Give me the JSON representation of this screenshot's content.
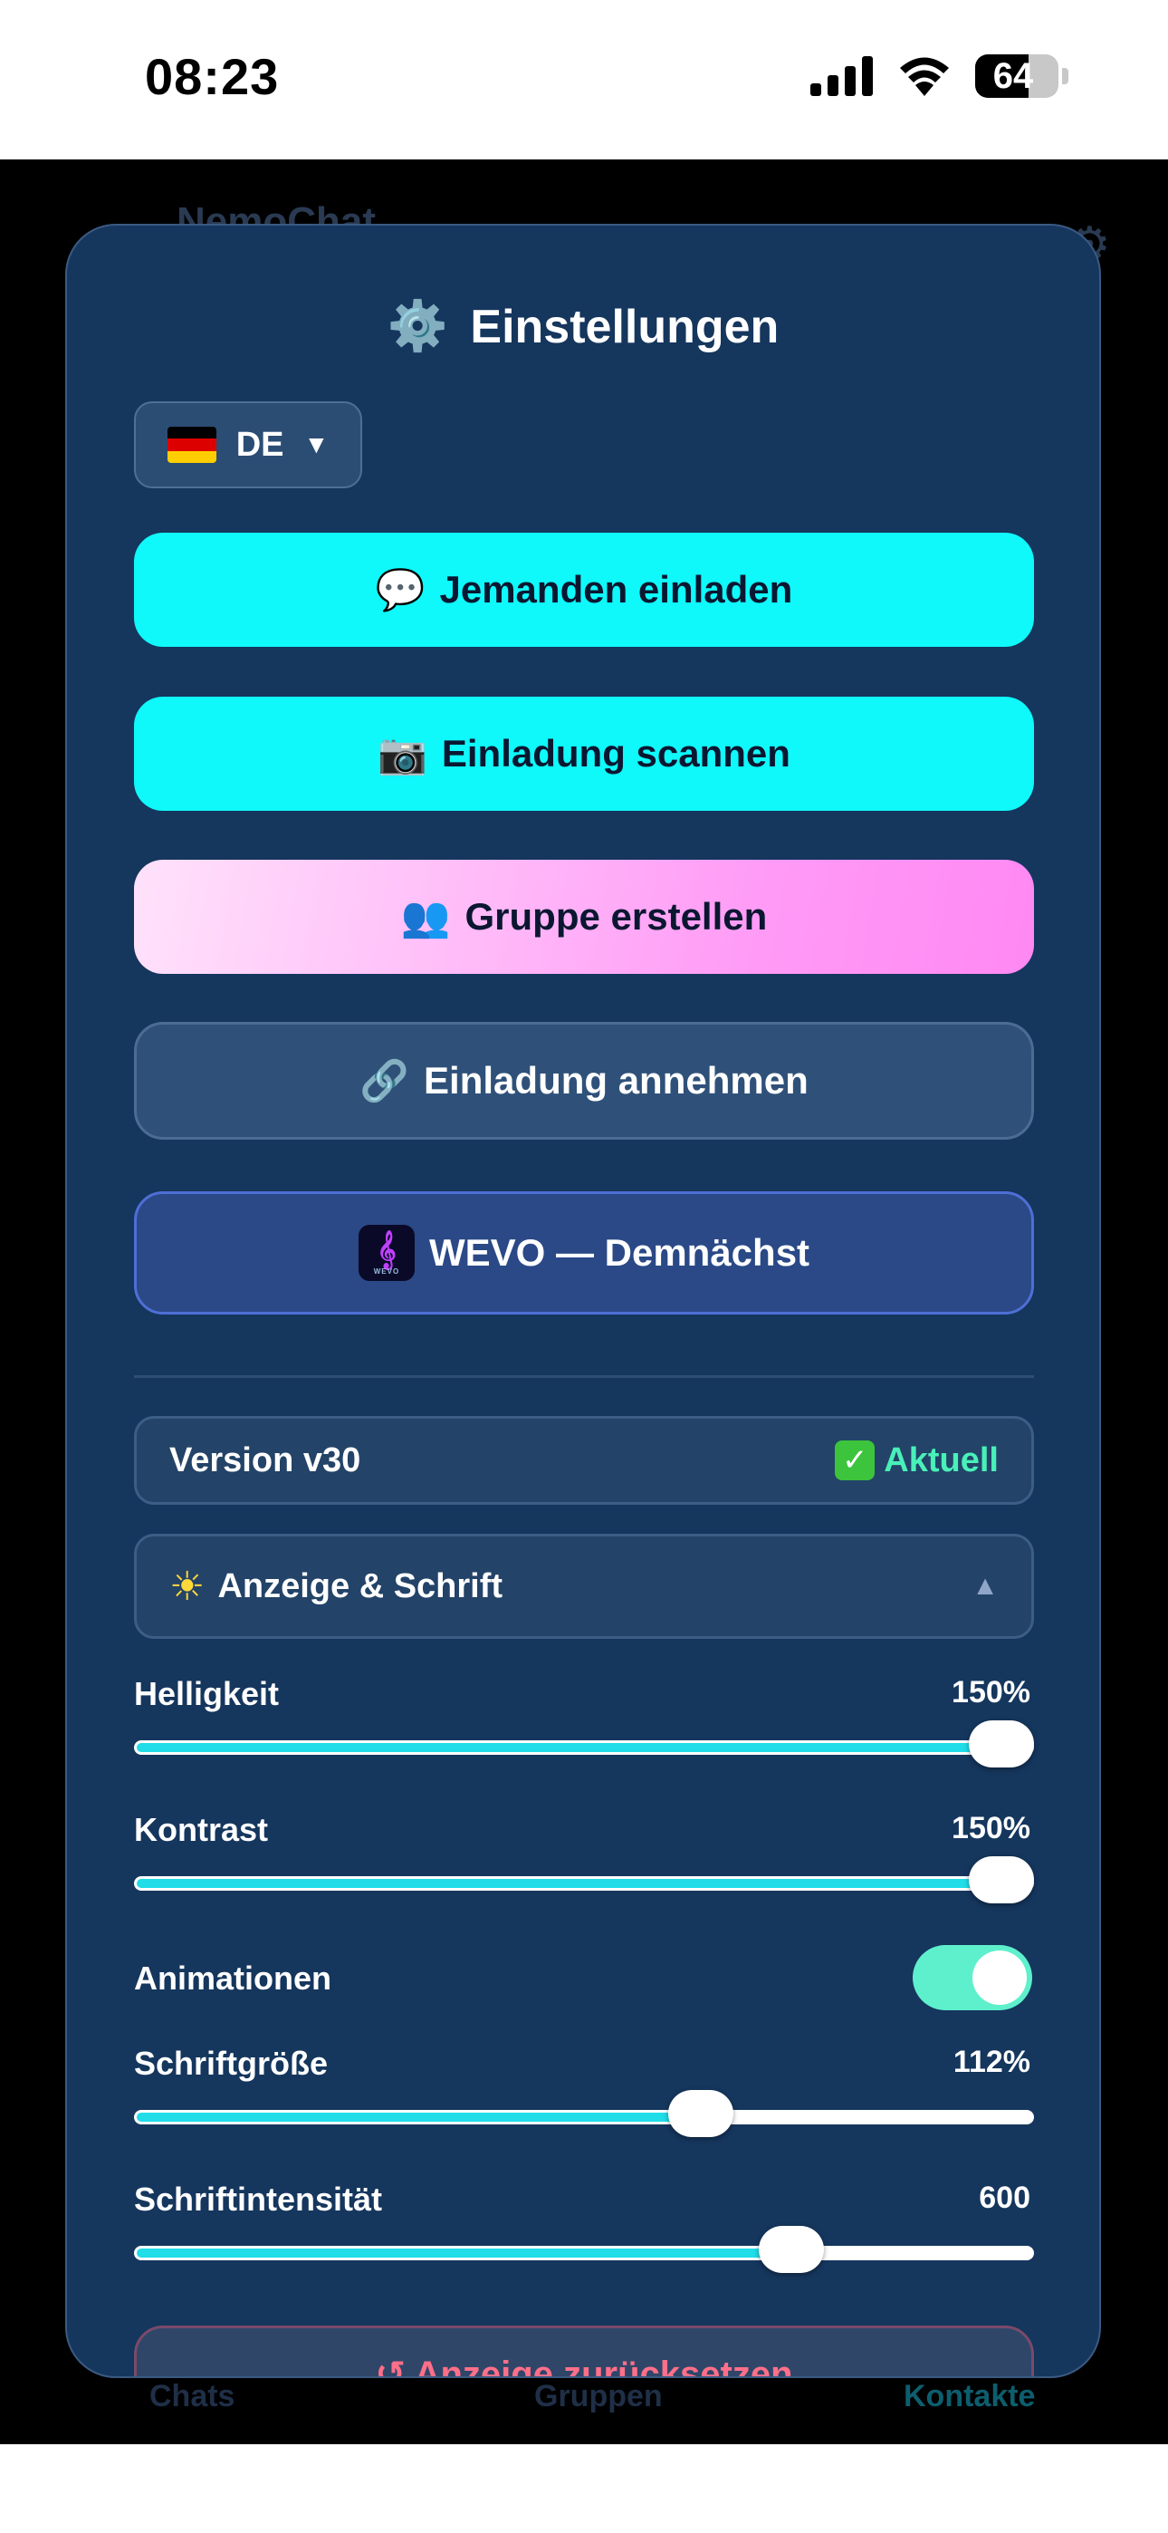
{
  "status_bar": {
    "time": "08:23",
    "battery": "64",
    "battery_level": 0.64
  },
  "background_app": {
    "title": "NemoChat",
    "nav": {
      "left": "Chats",
      "middle": "Gruppen",
      "right": "Kontakte"
    }
  },
  "settings": {
    "title": "Einstellungen",
    "title_icon": "gear-icon",
    "language": {
      "code": "DE",
      "flag": "flag-germany-icon"
    },
    "buttons": {
      "invite": {
        "icon": "💬",
        "label": "Jemanden einladen"
      },
      "scan": {
        "icon": "📷",
        "label": "Einladung scannen"
      },
      "group": {
        "icon": "👥",
        "label": "Gruppe erstellen"
      },
      "accept": {
        "icon": "🔗",
        "label": "Einladung annehmen"
      },
      "wevo": {
        "label": "WEVO — Demnächst"
      }
    },
    "version": {
      "label": "Version v30",
      "status": "Aktuell"
    },
    "display_section": {
      "icon": "☀",
      "label": "Anzeige & Schrift",
      "expanded_caret": "▲"
    },
    "sliders": {
      "brightness": {
        "label": "Helligkeit",
        "value": "150%",
        "fraction": 0.97
      },
      "contrast": {
        "label": "Kontrast",
        "value": "150%",
        "fraction": 0.97
      },
      "font_size": {
        "label": "Schriftgröße",
        "value": "112%",
        "fraction": 0.63
      },
      "font_weight": {
        "label": "Schriftintensität",
        "value": "600",
        "fraction": 0.73
      }
    },
    "animations": {
      "label": "Animationen",
      "enabled": true
    },
    "reset": {
      "label": "↺ Anzeige zurücksetzen"
    }
  },
  "colors": {
    "modal_bg": "#15365d",
    "cyan_button": "#0ff8fa",
    "pink_button": "#ff9af6",
    "slider_fill": "#20dde8",
    "toggle_on": "#5ef0cc",
    "success": "#49f0b8",
    "danger": "#ff6f8a"
  }
}
